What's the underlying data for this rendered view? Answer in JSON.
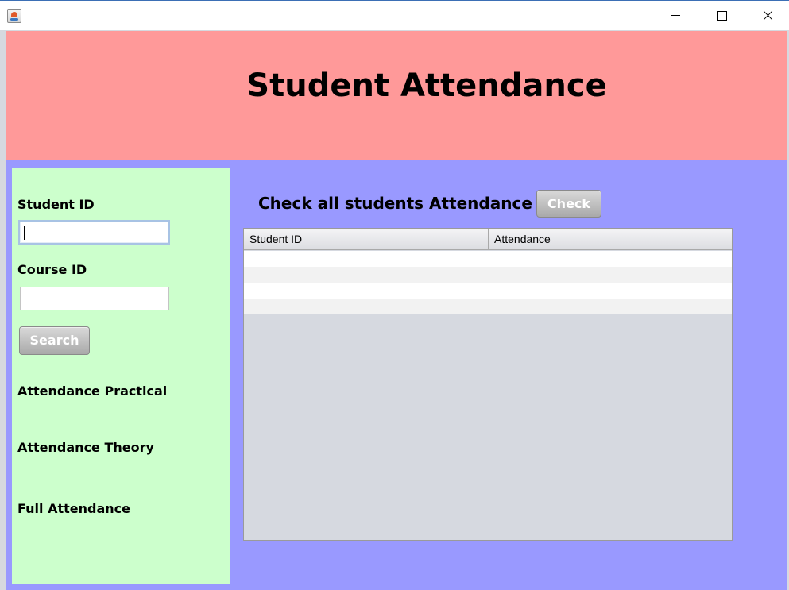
{
  "window": {
    "controls": [
      "minimize",
      "maximize",
      "close"
    ]
  },
  "header": {
    "title": "Student Attendance",
    "background": "#ff9999"
  },
  "main": {
    "background": "#9999ff"
  },
  "left_panel": {
    "background": "#ccffcc",
    "student_id_label": "Student ID",
    "student_id_value": "",
    "course_id_label": "Course ID",
    "course_id_value": "",
    "search_button": "Search",
    "attendance_practical_label": "Attendance Practical",
    "attendance_theory_label": "Attendance Theory",
    "full_attendance_label": "Full Attendance"
  },
  "check_section": {
    "label": "Check all students Attendance",
    "check_button": "Check"
  },
  "table": {
    "columns": [
      "Student ID",
      "Attendance"
    ],
    "rows": [
      [
        "",
        ""
      ],
      [
        "",
        ""
      ],
      [
        "",
        ""
      ],
      [
        "",
        ""
      ]
    ],
    "row_colors": [
      "#ffffff",
      "#f2f2f2"
    ]
  }
}
